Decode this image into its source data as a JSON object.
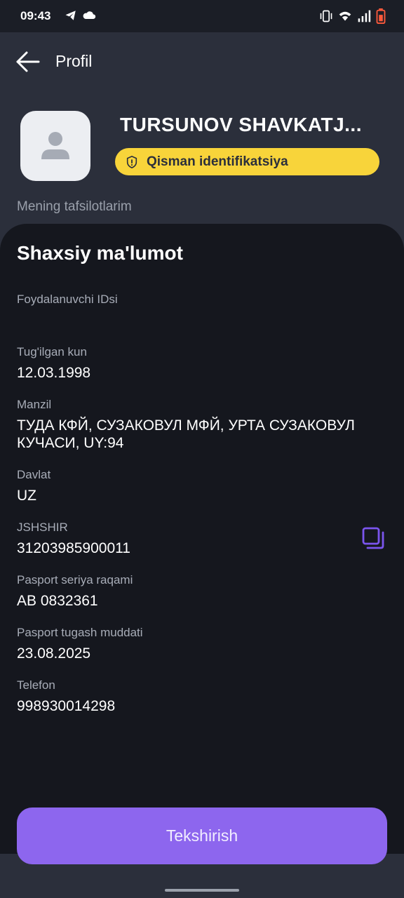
{
  "status_bar": {
    "time": "09:43",
    "icons": [
      "telegram-icon",
      "cloud-icon",
      "vibrate-icon",
      "wifi-icon",
      "signal-icon",
      "battery-icon"
    ]
  },
  "header": {
    "title": "Profil"
  },
  "profile": {
    "name": "TURSUNOV SHAVKATJ...",
    "status_badge": "Qisman identifikatsiya"
  },
  "section_caption": "Mening tafsilotlarim",
  "card": {
    "title": "Shaxsiy ma'lumot",
    "fields": [
      {
        "label": "Foydalanuvchi IDsi",
        "value": ""
      },
      {
        "label": "Tug'ilgan kun",
        "value": "12.03.1998"
      },
      {
        "label": "Manzil",
        "value": "ТУДА КФЙ, СУЗАКОВУЛ МФЙ, УРТА СУЗАКОВУЛ КУЧАСИ, UY:94"
      },
      {
        "label": "Davlat",
        "value": "UZ"
      },
      {
        "label": "JSHSHIR",
        "value": "31203985900011"
      },
      {
        "label": "Pasport seriya raqami",
        "value": "AB 0832361"
      },
      {
        "label": "Pasport tugash muddati",
        "value": "23.08.2025"
      },
      {
        "label": "Telefon",
        "value": "998930014298"
      }
    ]
  },
  "primary_button": {
    "label": "Tekshirish"
  },
  "colors": {
    "background": "#2b2f3b",
    "card": "#15171e",
    "badge": "#f8d43a",
    "accent": "#8d66ee"
  }
}
